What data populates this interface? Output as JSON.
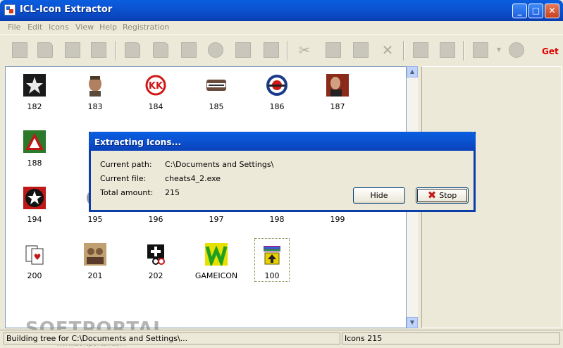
{
  "window": {
    "title": "ICL-Icon Extractor",
    "minimize": "_",
    "maximize": "□",
    "close": "✕"
  },
  "menu": [
    "File",
    "Edit",
    "Icons",
    "View",
    "Help",
    "Registration"
  ],
  "toolbar": {
    "get_label": "Get",
    "tools": [
      "new-file-icon",
      "open-folder-icon",
      "save-icon",
      "save-ico-icon",
      "folder-add-icon",
      "folder-scan-icon",
      "puzzle-icon",
      "globe-icon",
      "cubes-icon",
      "tree-icon",
      "cut-icon",
      "copy-icon",
      "paste-icon",
      "delete-icon",
      "info-icon",
      "book-icon",
      "keyboard-icon",
      "stop-hand-icon"
    ]
  },
  "icons": [
    {
      "label": "182",
      "icon": "star-icon",
      "color": "#1a1a1a"
    },
    {
      "label": "183",
      "icon": "soldier-face-icon",
      "color": "#8a6a4a"
    },
    {
      "label": "184",
      "icon": "kk-logo-icon",
      "color": "#d01818"
    },
    {
      "label": "185",
      "icon": "battlefield-icon",
      "color": "#5a3a2a"
    },
    {
      "label": "186",
      "icon": "target-plane-icon",
      "color": "#1a3a8a"
    },
    {
      "label": "187",
      "icon": "agent-face-icon",
      "color": "#8a2a1a"
    },
    {
      "label": "188",
      "icon": "warning-triangle-icon",
      "color": "#2a8a2a"
    },
    {
      "label": "194",
      "icon": "black-star-icon",
      "color": "#c01818"
    },
    {
      "label": "195",
      "icon": "gear-icon",
      "color": "#888888"
    },
    {
      "label": "196",
      "icon": "misc-icon",
      "color": "#888888"
    },
    {
      "label": "197",
      "icon": "misc-icon",
      "color": "#888888"
    },
    {
      "label": "198",
      "icon": "misc-icon",
      "color": "#888888"
    },
    {
      "label": "199",
      "icon": "misc-icon",
      "color": "#888888"
    },
    {
      "label": "200",
      "icon": "cards-icon",
      "color": "#c01818"
    },
    {
      "label": "201",
      "icon": "crowd-icon",
      "color": "#8a6a3a"
    },
    {
      "label": "202",
      "icon": "symbol-icon",
      "color": "#1a1a1a"
    },
    {
      "label": "GAMEICON",
      "icon": "green-w-icon",
      "color": "#2ab02a"
    },
    {
      "label": "100",
      "icon": "winrar-box-icon",
      "color": "#8a2aa0"
    }
  ],
  "dialog": {
    "title": "Extracting Icons...",
    "rows": [
      {
        "label": "Current path:",
        "value": "C:\\Documents and Settings\\"
      },
      {
        "label": "Current file:",
        "value": "cheats4_2.exe"
      },
      {
        "label": "Total amount:",
        "value": "215"
      }
    ],
    "hide_label": "Hide",
    "stop_label": "Stop"
  },
  "watermark": {
    "main": "SOFTPORTAL",
    "sub": "www.softportal.com"
  },
  "status": {
    "left": "Building tree for C:\\Documents and Settings\\...",
    "right": "Icons 215"
  }
}
